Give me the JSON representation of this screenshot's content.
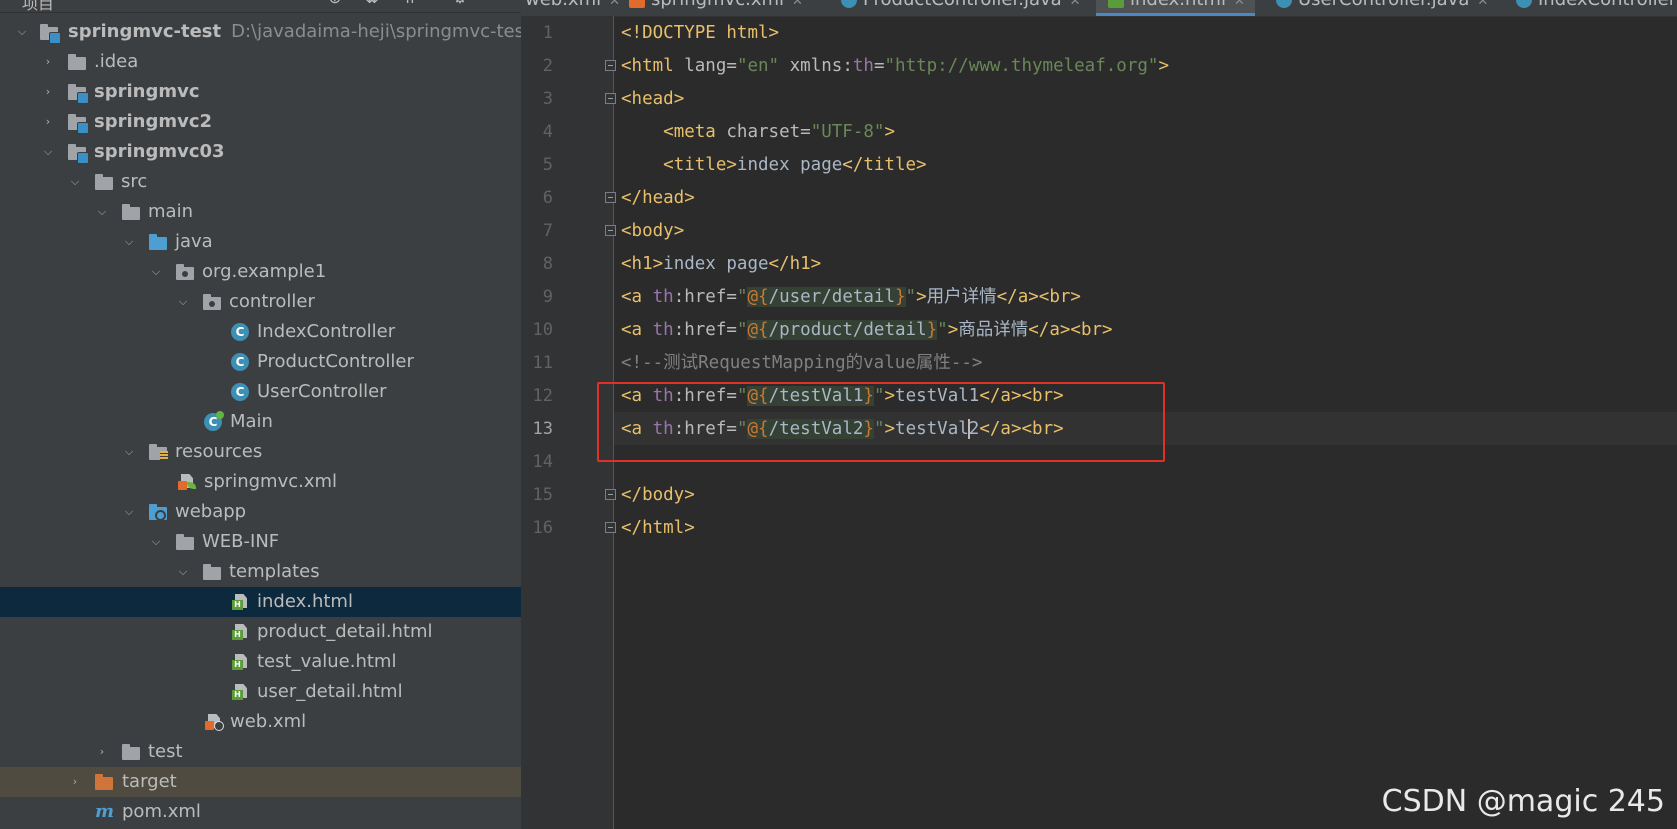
{
  "project_panel": {
    "title": "项目",
    "tree": [
      {
        "depth": 0,
        "expanded": true,
        "icon": "module-folder-icon",
        "label": "springmvc-test",
        "path": "D:\\javadaima-heji\\springmvc-test",
        "bold": true
      },
      {
        "depth": 1,
        "expanded": false,
        "icon": "folder-icon",
        "label": ".idea"
      },
      {
        "depth": 1,
        "expanded": false,
        "icon": "module-folder-icon",
        "label": "springmvc",
        "bold": true
      },
      {
        "depth": 1,
        "expanded": false,
        "icon": "module-folder-icon",
        "label": "springmvc2",
        "bold": true
      },
      {
        "depth": 1,
        "expanded": true,
        "icon": "module-folder-icon",
        "label": "springmvc03",
        "bold": true
      },
      {
        "depth": 2,
        "expanded": true,
        "icon": "folder-icon",
        "label": "src"
      },
      {
        "depth": 3,
        "expanded": true,
        "icon": "folder-icon",
        "label": "main"
      },
      {
        "depth": 4,
        "expanded": true,
        "icon": "source-folder-icon",
        "label": "java"
      },
      {
        "depth": 5,
        "expanded": true,
        "icon": "package-icon",
        "label": "org.example1"
      },
      {
        "depth": 6,
        "expanded": true,
        "icon": "package-icon",
        "label": "controller"
      },
      {
        "depth": 7,
        "icon": "class-icon",
        "label": "IndexController"
      },
      {
        "depth": 7,
        "icon": "class-icon",
        "label": "ProductController"
      },
      {
        "depth": 7,
        "icon": "class-icon",
        "label": "UserController"
      },
      {
        "depth": 6,
        "icon": "main-class-icon",
        "label": "Main"
      },
      {
        "depth": 4,
        "expanded": true,
        "icon": "resources-folder-icon",
        "label": "resources"
      },
      {
        "depth": 5,
        "icon": "spring-xml-icon",
        "label": "springmvc.xml"
      },
      {
        "depth": 4,
        "expanded": true,
        "icon": "web-folder-icon",
        "label": "webapp"
      },
      {
        "depth": 5,
        "expanded": true,
        "icon": "folder-icon",
        "label": "WEB-INF"
      },
      {
        "depth": 6,
        "expanded": true,
        "icon": "folder-icon",
        "label": "templates"
      },
      {
        "depth": 7,
        "icon": "html-file-icon",
        "label": "index.html",
        "selected": true
      },
      {
        "depth": 7,
        "icon": "html-file-icon",
        "label": "product_detail.html"
      },
      {
        "depth": 7,
        "icon": "html-file-icon",
        "label": "test_value.html"
      },
      {
        "depth": 7,
        "icon": "html-file-icon",
        "label": "user_detail.html"
      },
      {
        "depth": 6,
        "icon": "web-xml-icon",
        "label": "web.xml"
      },
      {
        "depth": 3,
        "expanded": false,
        "icon": "folder-icon",
        "label": "test"
      },
      {
        "depth": 2,
        "expanded": false,
        "icon": "excluded-folder-icon",
        "label": "target",
        "excluded": true
      },
      {
        "depth": 2,
        "icon": "maven-icon",
        "label": "pom.xml"
      }
    ]
  },
  "tabs": [
    {
      "label": "web.xml",
      "icon": "xml"
    },
    {
      "label": "springmvc.xml",
      "icon": "xml"
    },
    {
      "label": "ProductController.java",
      "icon": "class"
    },
    {
      "label": "index.html",
      "icon": "html",
      "active": true
    },
    {
      "label": "UserController.java",
      "icon": "class"
    },
    {
      "label": "IndexController",
      "icon": "class"
    }
  ],
  "editor": {
    "line_numbers": [
      "1",
      "2",
      "3",
      "4",
      "5",
      "6",
      "7",
      "8",
      "9",
      "10",
      "11",
      "12",
      "13",
      "14",
      "15",
      "16"
    ],
    "lines": [
      "<!DOCTYPE html>",
      "<html lang=\"en\" xmlns:th=\"http://www.thymeleaf.org\">",
      "<head>",
      "    <meta charset=\"UTF-8\">",
      "    <title>index page</title>",
      "</head>",
      "<body>",
      "<h1>index page</h1>",
      "<a th:href=\"@{/user/detail}\">用户详情</a><br>",
      "<a th:href=\"@{/product/detail}\">商品详情</a><br>",
      "<!--测试RequestMapping的value属性-->",
      "<a th:href=\"@{/testVal1}\">testVal1</a><br>",
      "<a th:href=\"@{/testVal2}\">testVal2</a><br>",
      "",
      "</body>",
      "</html>"
    ],
    "current_line": "13"
  },
  "watermark": "CSDN @magic 245",
  "colors": {
    "panel_bg": "#3c3f41",
    "editor_bg": "#2b2b2b",
    "tag": "#e8bf6a",
    "value": "#6a8759",
    "namespace": "#9876aa",
    "comment": "#808080",
    "selection": "#0d293e",
    "highlight_box": "#e0302a"
  }
}
